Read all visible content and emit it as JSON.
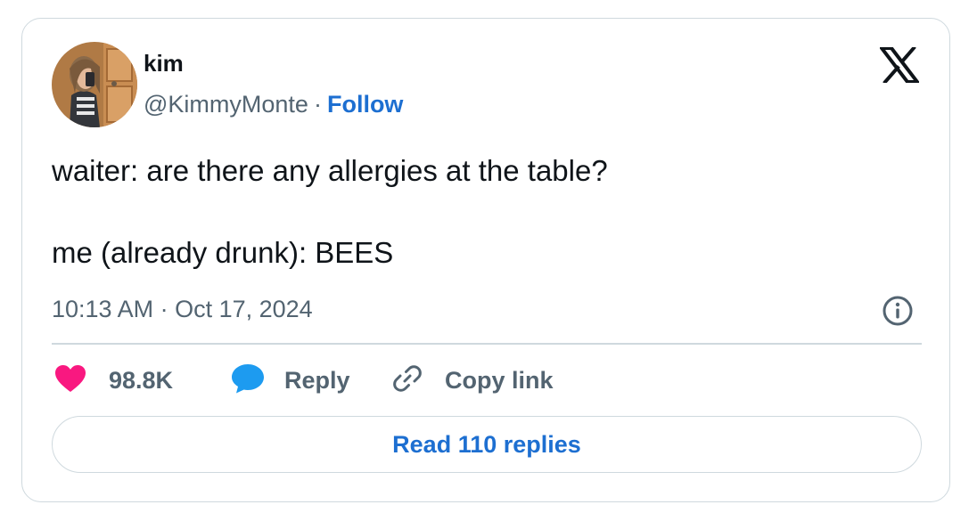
{
  "author": {
    "name": "kim",
    "handle": "@KimmyMonte",
    "separator": "·",
    "follow_label": "Follow"
  },
  "tweet": {
    "lines": [
      "waiter: are there any allergies at the table?",
      "me (already drunk): BEES"
    ],
    "timestamp": "10:13 AM · Oct 17, 2024"
  },
  "actions": {
    "like_count": "98.8K",
    "reply_label": "Reply",
    "copy_label": "Copy link"
  },
  "read_replies_label": "Read 110 replies",
  "icons": {
    "brand": "x-logo-icon",
    "info": "info-icon",
    "like": "heart-icon",
    "reply": "speech-bubble-icon",
    "copy": "link-icon"
  },
  "colors": {
    "like": "#f91880",
    "reply": "#1d9bf0",
    "link": "#1d6fd1",
    "muted": "#536471",
    "border": "#cfd9de"
  }
}
